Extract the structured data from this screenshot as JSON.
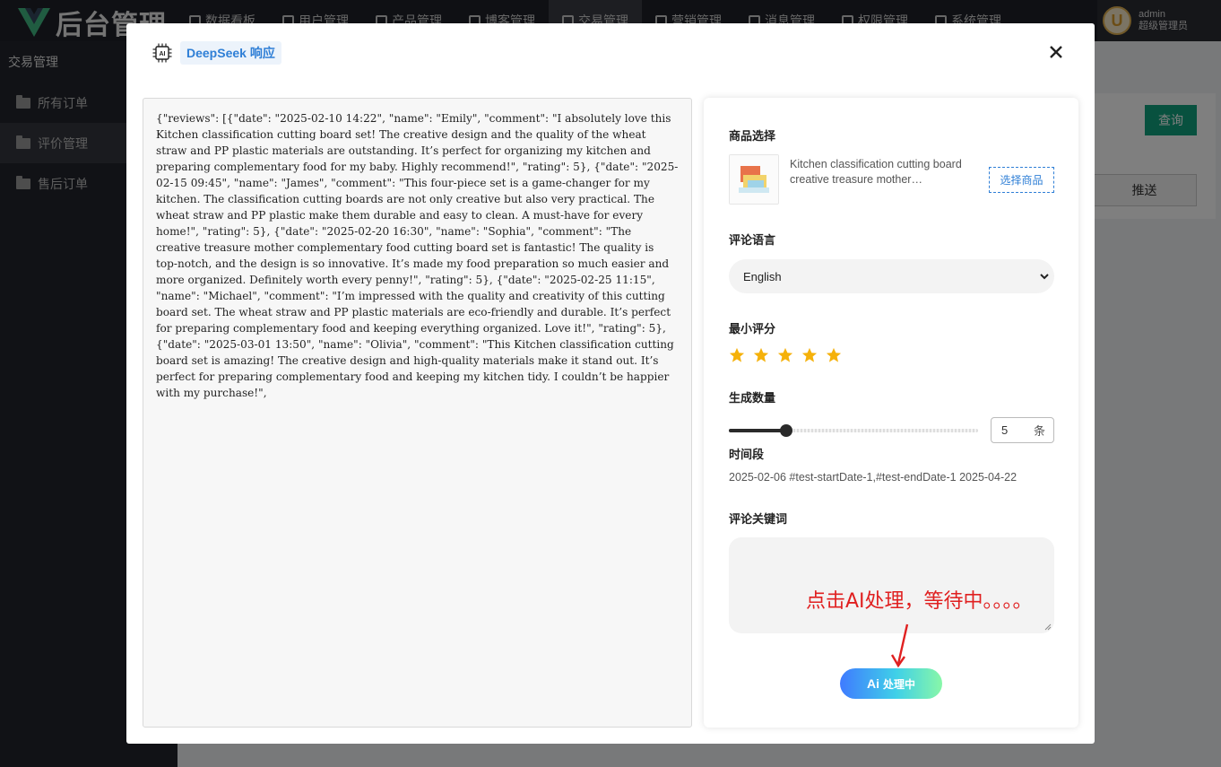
{
  "app": {
    "logo_text": "后台管理"
  },
  "nav": [
    "数据看板",
    "用户管理",
    "产品管理",
    "博客管理",
    "交易管理",
    "营销管理",
    "消息管理",
    "权限管理",
    "系统管理"
  ],
  "nav_active_index": 4,
  "user": {
    "avatar_letter": "U",
    "name": "admin",
    "role": "超级管理员"
  },
  "sidebar": {
    "title": "交易管理",
    "items": [
      {
        "label": "所有订单"
      },
      {
        "label": "评价管理"
      },
      {
        "label": "售后订单"
      }
    ],
    "active_index": 1
  },
  "background": {
    "query_button": "查询",
    "push_button": "推送"
  },
  "modal": {
    "title": "DeepSeek 响应",
    "response_text": "{\"reviews\": [{\"date\": \"2025-02-10 14:22\", \"name\": \"Emily\", \"comment\": \"I absolutely love this Kitchen classification cutting board set! The creative design and the quality of the wheat straw and PP plastic materials are outstanding. It’s perfect for organizing my kitchen and preparing complementary food for my baby. Highly recommend!\", \"rating\": 5}, {\"date\": \"2025-02-15 09:45\", \"name\": \"James\", \"comment\": \"This four-piece set is a game-changer for my kitchen. The classification cutting boards are not only creative but also very practical. The wheat straw and PP plastic make them durable and easy to clean. A must-have for every home!\", \"rating\": 5}, {\"date\": \"2025-02-20 16:30\", \"name\": \"Sophia\", \"comment\": \"The creative treasure mother complementary food cutting board set is fantastic! The quality is top-notch, and the design is so innovative. It’s made my food preparation so much easier and more organized. Definitely worth every penny!\", \"rating\": 5}, {\"date\": \"2025-02-25 11:15\", \"name\": \"Michael\", \"comment\": \"I’m impressed with the quality and creativity of this cutting board set. The wheat straw and PP plastic materials are eco-friendly and durable. It’s perfect for preparing complementary food and keeping everything organized. Love it!\", \"rating\": 5}, {\"date\": \"2025-03-01 13:50\", \"name\": \"Olivia\", \"comment\": \"This Kitchen classification cutting board set is amazing! The creative design and high-quality materials make it stand out. It’s perfect for preparing complementary food and keeping my kitchen tidy. I couldn’t be happier with my purchase!\","
  },
  "form": {
    "product_label": "商品选择",
    "product_name": "Kitchen classification cutting board creative treasure mother…",
    "select_product_button": "选择商品",
    "language_label": "评论语言",
    "language_value": "English",
    "min_rating_label": "最小评分",
    "min_rating": 5,
    "max_rating": 5,
    "star_color": "#f5b10a",
    "count_label": "生成数量",
    "count_value": "5",
    "count_unit": "条",
    "count_slider_fraction": 0.23,
    "period_label": "时间段",
    "period_value": "2025-02-06 #test-startDate-1,#test-endDate-1 2025-04-22",
    "keywords_label": "评论关键词",
    "ai_button_glyph": "Ai",
    "ai_button_label": "处理中"
  },
  "annotation": {
    "text": "点击AI处理，等待中。。。。",
    "color": "#e02020"
  }
}
